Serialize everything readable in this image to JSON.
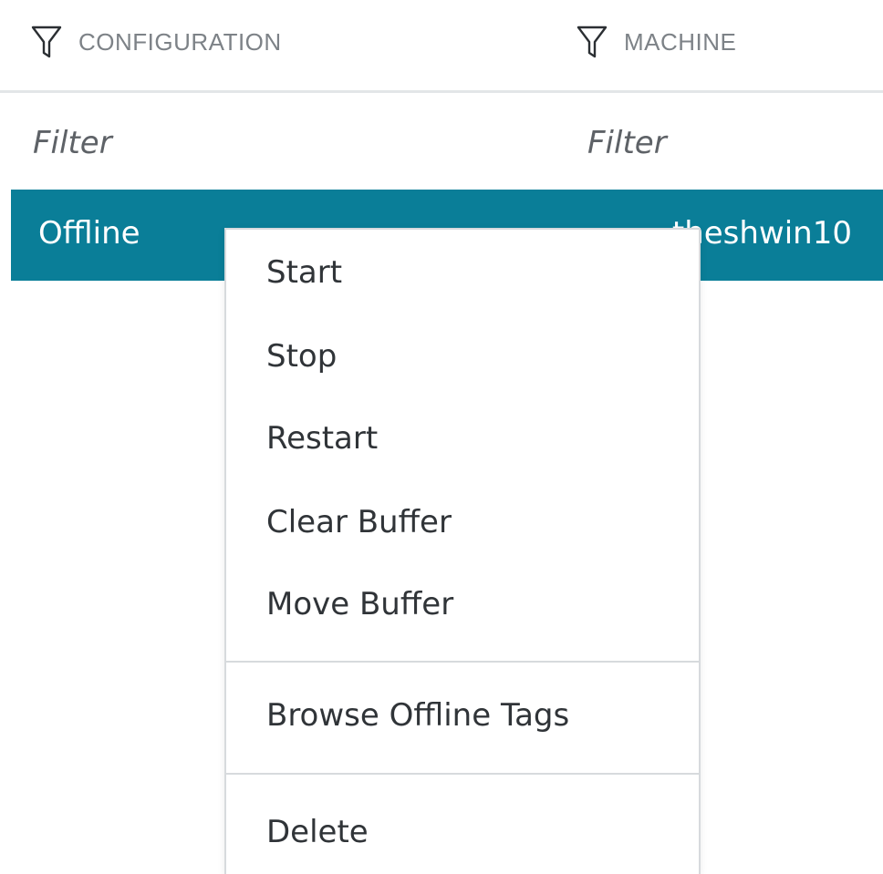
{
  "columns": {
    "configuration": {
      "label": "CONFIGURATION",
      "icon": "funnel-filter-icon",
      "filter_placeholder": "Filter"
    },
    "machine": {
      "label": "MACHINE",
      "icon": "funnel-filter-icon",
      "filter_placeholder": "Filter"
    }
  },
  "selected_row": {
    "configuration": "Offline",
    "machine": "theshwin10"
  },
  "context_menu": {
    "items": [
      {
        "label": "Start"
      },
      {
        "label": "Stop"
      },
      {
        "label": "Restart"
      },
      {
        "label": "Clear Buffer"
      },
      {
        "label": "Move Buffer"
      },
      {
        "label": "Browse Offline Tags"
      },
      {
        "label": "Delete"
      }
    ]
  },
  "colors": {
    "selected_row_bg": "#0a7e98",
    "header_text": "#7d8287",
    "menu_text": "#303438",
    "divider": "#d7dadd"
  }
}
